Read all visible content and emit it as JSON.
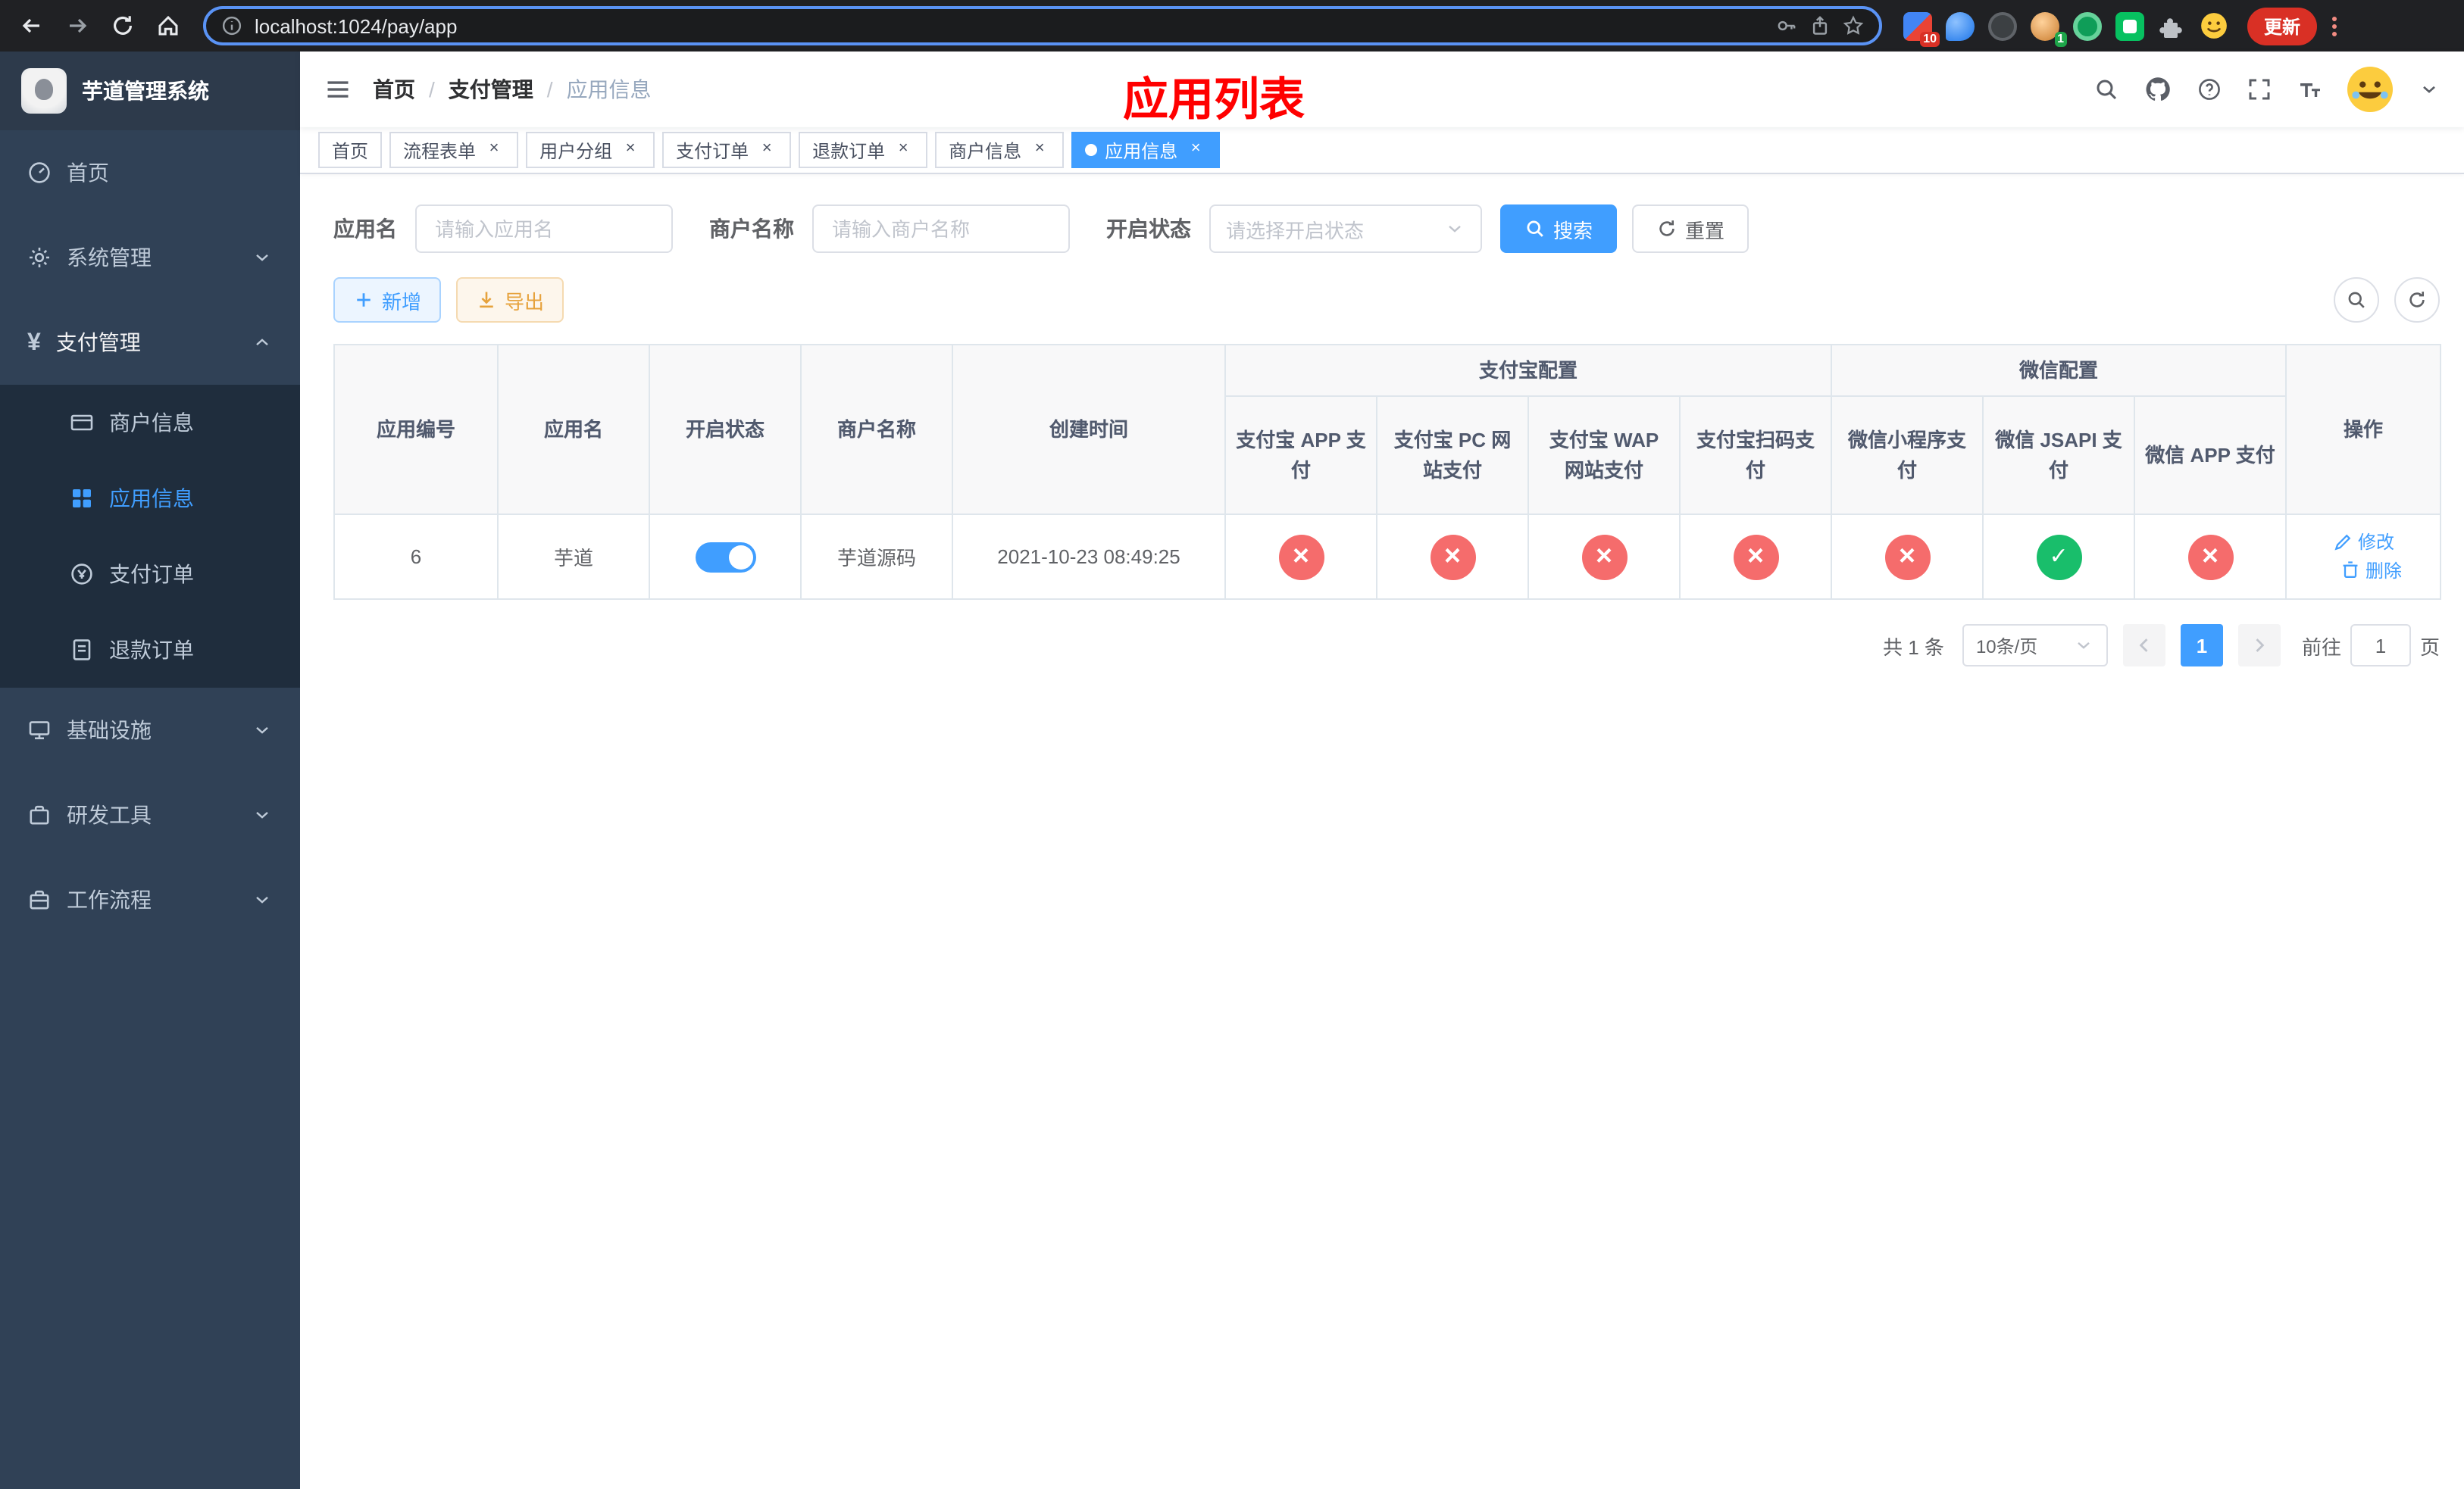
{
  "browser": {
    "url": "localhost:1024/pay/app",
    "update_label": "更新",
    "ext_badge_a": "10",
    "ext_badge_b": "1"
  },
  "sidebar": {
    "title": "芋道管理系统",
    "items": [
      {
        "label": "首页"
      },
      {
        "label": "系统管理"
      },
      {
        "label": "支付管理"
      },
      {
        "label": "基础设施"
      },
      {
        "label": "研发工具"
      },
      {
        "label": "工作流程"
      }
    ],
    "pay_submenu": [
      {
        "label": "商户信息"
      },
      {
        "label": "应用信息"
      },
      {
        "label": "支付订单"
      },
      {
        "label": "退款订单"
      }
    ]
  },
  "header": {
    "breadcrumb": [
      {
        "label": "首页"
      },
      {
        "label": "支付管理"
      },
      {
        "label": "应用信息"
      }
    ],
    "annotation": "应用列表"
  },
  "tabs": [
    {
      "label": "首页"
    },
    {
      "label": "流程表单"
    },
    {
      "label": "用户分组"
    },
    {
      "label": "支付订单"
    },
    {
      "label": "退款订单"
    },
    {
      "label": "商户信息"
    },
    {
      "label": "应用信息"
    }
  ],
  "filters": {
    "app_name": {
      "label": "应用名",
      "placeholder": "请输入应用名",
      "value": ""
    },
    "merchant_name": {
      "label": "商户名称",
      "placeholder": "请输入商户名称",
      "value": ""
    },
    "status": {
      "label": "开启状态",
      "placeholder": "请选择开启状态"
    },
    "search": "搜索",
    "reset": "重置"
  },
  "toolbar": {
    "add": "新增",
    "export": "导出"
  },
  "table": {
    "group_headers": {
      "alipay": "支付宝配置",
      "wechat": "微信配置"
    },
    "columns": {
      "app_id": "应用编号",
      "app_name": "应用名",
      "status": "开启状态",
      "merchant": "商户名称",
      "create_time": "创建时间",
      "alipay_app": "支付宝 APP 支付",
      "alipay_pc": "支付宝 PC 网站支付",
      "alipay_wap": "支付宝 WAP 网站支付",
      "alipay_qr": "支付宝扫码支付",
      "wx_lite": "微信小程序支付",
      "wx_jsapi": "微信 JSAPI 支付",
      "wx_app": "微信 APP 支付",
      "ops": "操作"
    },
    "row": {
      "app_id": "6",
      "app_name": "芋道",
      "status_on": true,
      "merchant": "芋道源码",
      "create_time": "2021-10-23 08:49:25",
      "configs": [
        "fail",
        "fail",
        "fail",
        "fail",
        "fail",
        "success",
        "fail"
      ],
      "edit": "修改",
      "delete": "删除"
    }
  },
  "pagination": {
    "total": "共 1 条",
    "page_size": "10条/页",
    "current_page": "1",
    "goto_label": "前往",
    "goto_value": "1",
    "goto_suffix": "页"
  },
  "colors": {
    "primary": "#409eff",
    "success": "#19be6b",
    "danger": "#f56c6c",
    "annotation_red": "#ff0000",
    "sidebar_bg": "#304156",
    "submenu_bg": "#1f2d3d"
  }
}
